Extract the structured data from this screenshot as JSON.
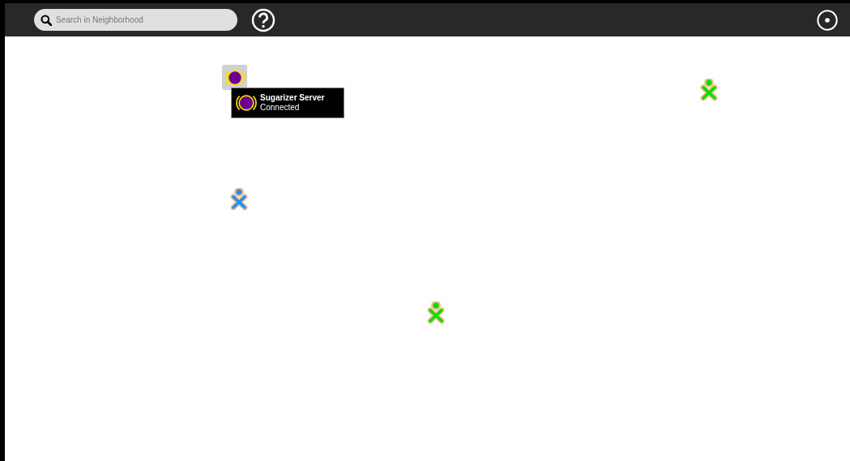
{
  "toolbar": {
    "search": {
      "placeholder": "Search in Neighborhood"
    }
  },
  "server": {
    "name": "Sugarizer Server",
    "status": "Connected"
  },
  "buddies": [
    {
      "color": "#00e000"
    },
    {
      "color": "#1e90ff"
    },
    {
      "color": "#00e000"
    }
  ]
}
